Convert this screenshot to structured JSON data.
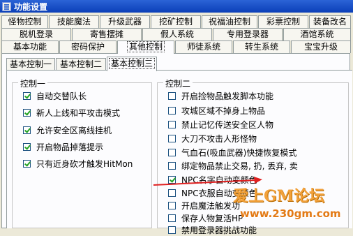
{
  "window": {
    "title": "功能设置"
  },
  "main_tabs": {
    "row1": [
      "怪物控制",
      "技能魔法",
      "升级武器",
      "挖矿控制",
      "祝福油控制",
      "彩票控制",
      "装备改名"
    ],
    "row2": [
      "脱机登录",
      "寄售摆摊",
      "假人系统",
      "专用登录器",
      "酒馆系统"
    ],
    "row3": [
      "基本功能",
      "密码保护",
      "其他控制",
      "师徒系统",
      "转生系统",
      "宝宝升级"
    ],
    "active": "其他控制"
  },
  "sub_tabs": {
    "items": [
      "基本控制一",
      "基本控制二",
      "基本控制三"
    ],
    "active": "基本控制三"
  },
  "group1": {
    "title": "控制一",
    "items": [
      {
        "label": "自动交替队长",
        "checked": true
      },
      {
        "label": "新人上线和平攻击模式",
        "checked": true
      },
      {
        "label": "允许安全区离线挂机",
        "checked": true
      },
      {
        "label": "开启物品掉落提示",
        "checked": true
      },
      {
        "label": "只有近身砍才触发HitMon",
        "checked": true
      }
    ]
  },
  "group2": {
    "title": "控制二",
    "items": [
      {
        "label": "开启捡物品触发脚本功能",
        "checked": false
      },
      {
        "label": "攻城区域不掉身上物品",
        "checked": false
      },
      {
        "label": "禁止记忆传送安全区人物",
        "checked": false
      },
      {
        "label": "大刀不攻击人形怪物",
        "checked": false
      },
      {
        "label": "气血石(吸血武器)快捷恢复模式",
        "checked": false
      },
      {
        "label": "绑定物品禁止交易, 扔, 丢弃, 卖",
        "checked": false
      },
      {
        "label": "NPC名字自动变颜色",
        "checked": true
      },
      {
        "label": "NPC衣服自动变颜色",
        "checked": false
      },
      {
        "label": "开启魔法触发功",
        "checked": false
      },
      {
        "label": "保存人物复活HP",
        "checked": false
      },
      {
        "label": "禁用登录器挑战功能",
        "checked": false
      }
    ]
  },
  "watermark": {
    "logo": "爱上GM论坛",
    "url": "www.230gm.com"
  },
  "colors": {
    "title_bar": "#0b3fb8",
    "panel": "#fcfcfe",
    "arrow": "#e02020",
    "watermark": "#f2a13a"
  }
}
